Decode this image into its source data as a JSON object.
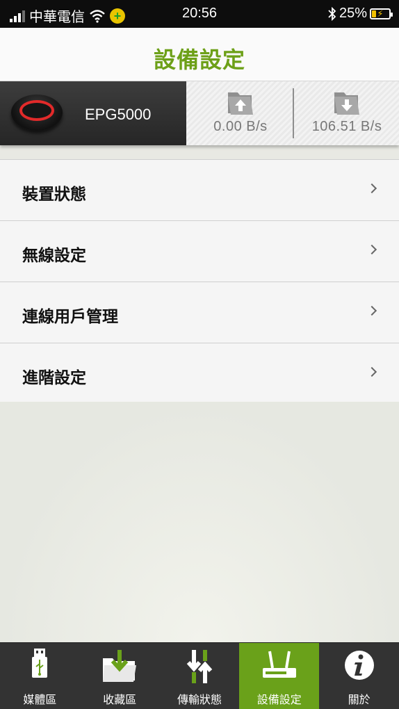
{
  "status_bar": {
    "carrier": "中華電信",
    "time": "20:56",
    "battery": "25%",
    "battery_level": 0.25,
    "icons": [
      "signal-icon",
      "wifi-icon",
      "plus-app-icon",
      "bluetooth-icon",
      "battery-charging-icon"
    ]
  },
  "header": {
    "title": "設備設定"
  },
  "device": {
    "name": "EPG5000",
    "upload_speed": "0.00  B/s",
    "download_speed": "106.51  B/s",
    "upload_icon": "upload-folder-icon",
    "download_icon": "download-folder-icon"
  },
  "menu": {
    "items": [
      {
        "label": "裝置狀態"
      },
      {
        "label": "無線設定"
      },
      {
        "label": "連線用戶管理"
      },
      {
        "label": "進階設定"
      }
    ]
  },
  "tabs": [
    {
      "label": "媒體區",
      "icon": "usb-icon"
    },
    {
      "label": "收藏區",
      "icon": "folder-download-icon"
    },
    {
      "label": "傳輸狀態",
      "icon": "transfer-arrows-icon"
    },
    {
      "label": "設備設定",
      "icon": "router-icon",
      "active": true
    },
    {
      "label": "關於",
      "icon": "info-icon"
    }
  ],
  "colors": {
    "accent_green": "#6da018",
    "tab_active": "#6aa11a",
    "device_ring": "#e22a2a"
  }
}
